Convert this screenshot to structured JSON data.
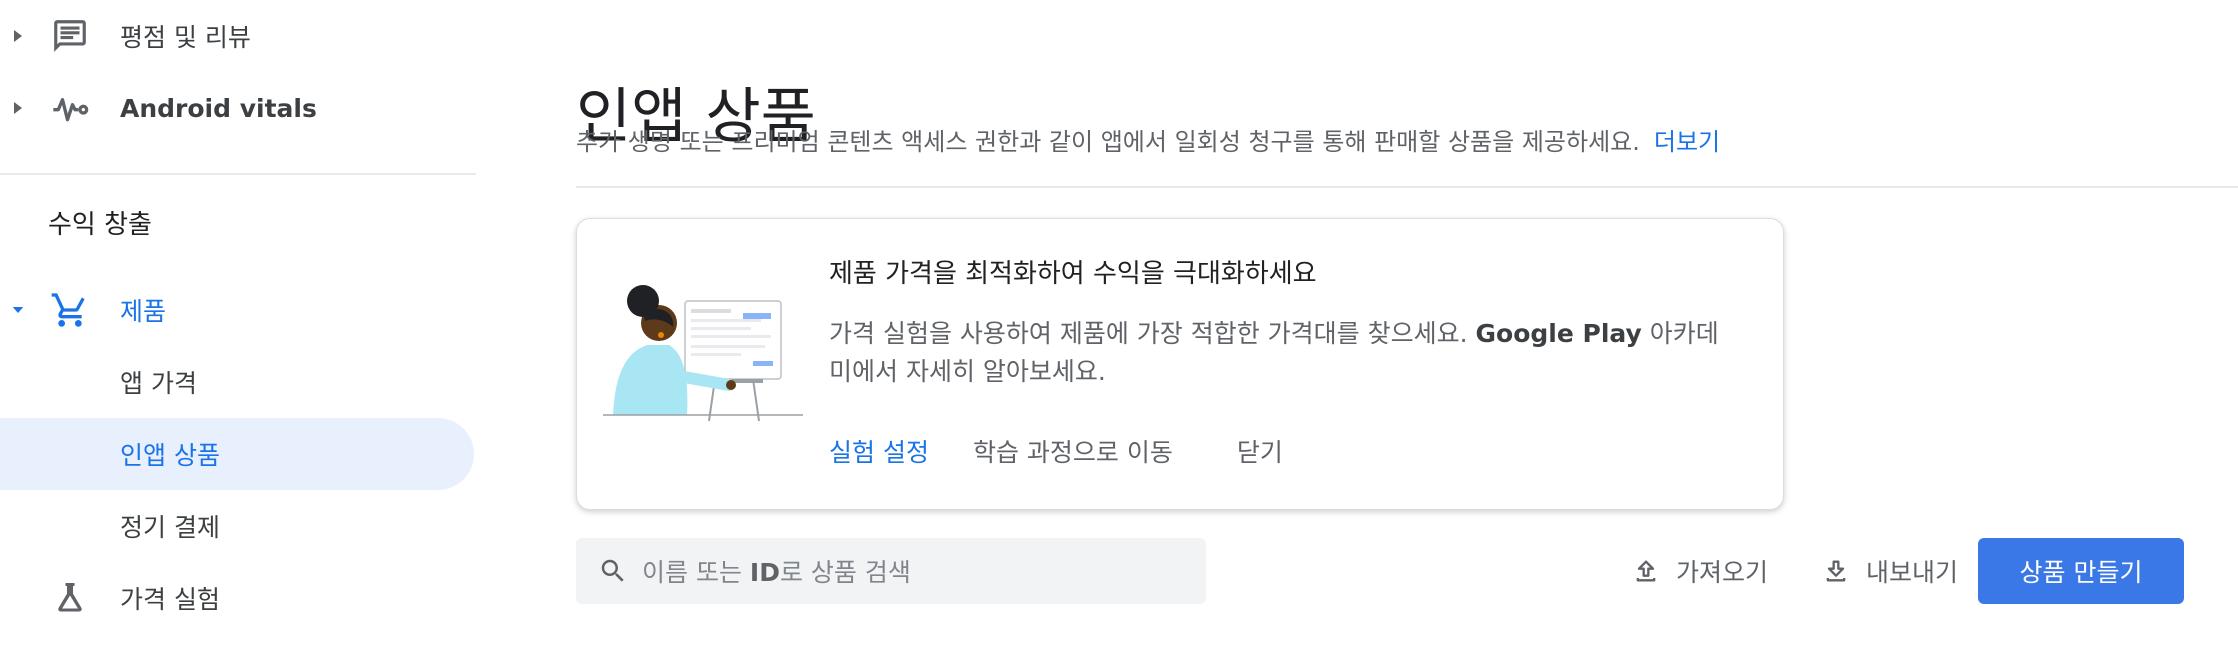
{
  "sidebar": {
    "ratings_label": "평점 및 리뷰",
    "vitals_label": "Android vitals",
    "section_title": "수익 창출",
    "products_label": "제품",
    "items": [
      {
        "label": "앱 가격"
      },
      {
        "label": "인앱 상품"
      },
      {
        "label": "정기 결제"
      }
    ],
    "experiments_label": "가격 실험"
  },
  "page": {
    "title": "인앱 상품",
    "description": "추가 생명 또는 프리미엄 콘텐츠 액세스 권한과 같이 앱에서 일회성 청구를 통해 판매할 상품을 제공하세요.",
    "more_link": "더보기"
  },
  "card": {
    "title": "제품 가격을 최적화하여 수익을 극대화하세요",
    "body_part1": "가격 실험을 사용하여 제품에 가장 적합한 가격대를 찾으세요. ",
    "body_bold": "Google Play",
    "body_part2": " 아카데미에서 자세히 알아보세요.",
    "action_primary": "실험 설정",
    "action_secondary": "학습 과정으로 이동",
    "action_close": "닫기"
  },
  "search": {
    "placeholder_part1": "이름 또는 ",
    "placeholder_bold": "ID",
    "placeholder_part2": "로 상품 검색"
  },
  "toolbar": {
    "import_label": "가져오기",
    "export_label": "내보내기",
    "create_label": "상품 만들기"
  },
  "colors": {
    "accent": "#1a73e8",
    "active_bg": "#e8f0fe",
    "primary_button": "#3b78e7"
  }
}
